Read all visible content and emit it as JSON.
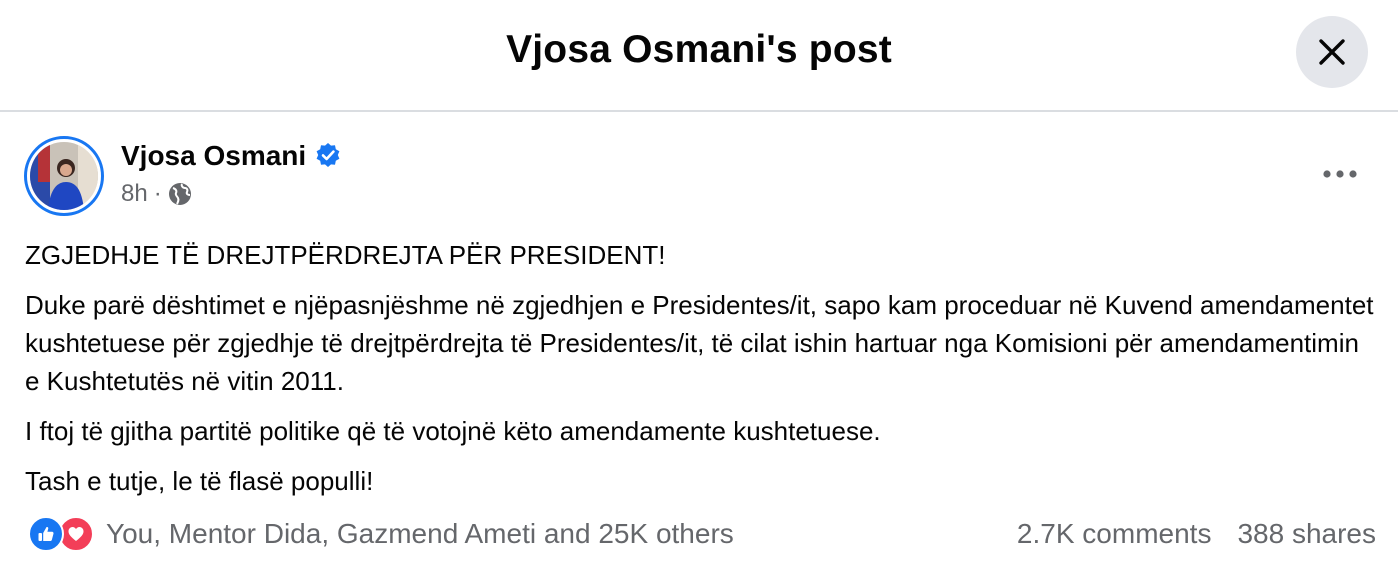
{
  "dialog": {
    "title": "Vjosa Osmani's post"
  },
  "post": {
    "author": "Vjosa Osmani",
    "time": "8h",
    "separator": "·",
    "paragraphs": [
      "ZGJEDHJE TË DREJTPËRDREJTA PËR PRESIDENT!",
      "Duke parë dështimet e njëpasnjëshme në zgjedhjen e Presidentes/it, sapo kam proceduar në Kuvend amendamentet kushtetuese për zgjedhje të drejtpërdrejta të Presidentes/it, të cilat ishin hartuar nga Komisioni për amendamentimin e Kushtetutës në vitin 2011.",
      "I ftoj të gjitha partitë politike që të votojnë këto amendamente kushtetuese.",
      "Tash e tutje, le të flasë populli!"
    ]
  },
  "footer": {
    "reactors": "You, Mentor Dida, Gazmend Ameti and 25K others",
    "comments": "2.7K comments",
    "shares": "388 shares"
  },
  "icons": {
    "close": "close-icon",
    "verified": "verified-badge-icon",
    "globe": "globe-icon",
    "more": "more-options-icon",
    "like": "like-reaction-icon",
    "love": "love-reaction-icon"
  },
  "colors": {
    "accent": "#1877f2",
    "love": "#f33e58",
    "secondary_text": "#65676b",
    "divider": "#dadde1"
  }
}
